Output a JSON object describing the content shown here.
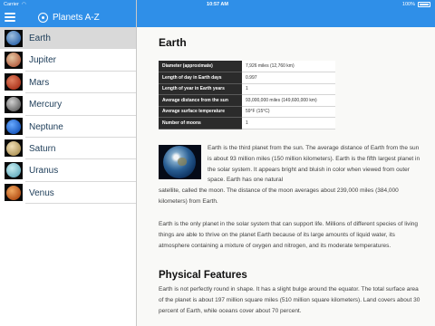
{
  "status_bar": {
    "carrier": "Carrier",
    "time": "10:57 AM",
    "battery": "100%"
  },
  "sidebar": {
    "title": "Planets A-Z",
    "planets": [
      {
        "name": "Earth",
        "selected": true,
        "colors": [
          "#3a6fb0",
          "#9fc0df"
        ]
      },
      {
        "name": "Jupiter",
        "selected": false,
        "colors": [
          "#b9684a",
          "#e4c7a3"
        ]
      },
      {
        "name": "Mars",
        "selected": false,
        "colors": [
          "#b13a22",
          "#e08060"
        ]
      },
      {
        "name": "Mercury",
        "selected": false,
        "colors": [
          "#6e6e6e",
          "#d0d0d0"
        ]
      },
      {
        "name": "Neptune",
        "selected": false,
        "colors": [
          "#1f5fc4",
          "#68a9ff"
        ]
      },
      {
        "name": "Saturn",
        "selected": false,
        "colors": [
          "#b59b60",
          "#f0dfb6"
        ]
      },
      {
        "name": "Uranus",
        "selected": false,
        "colors": [
          "#6fb4c4",
          "#c6eef2"
        ]
      },
      {
        "name": "Venus",
        "selected": false,
        "colors": [
          "#b9561b",
          "#f0a860"
        ]
      }
    ]
  },
  "detail": {
    "title": "Earth",
    "facts": [
      {
        "label": "Diameter (approximate)",
        "value": "7,926 miles (12,760 km)"
      },
      {
        "label": "Length of day in Earth days",
        "value": "0.997"
      },
      {
        "label": "Length of year in Earth years",
        "value": "1"
      },
      {
        "label": "Average distance from the sun",
        "value": "93,000,000 miles (149,600,000 km)"
      },
      {
        "label": "Average surface temperature",
        "value": "59°F (15°C)"
      },
      {
        "label": "Number of moons",
        "value": "1"
      }
    ],
    "para1_wrap": "Earth is the third planet from the sun. The average distance of Earth from the sun is about 93 million miles (150 million kilometers). Earth is the fifth largest planet in the solar system. It appears bright and bluish in color when viewed from outer space. Earth has one natural",
    "para1_rest": "satellite, called the moon. The distance of the moon averages about 239,000 miles (384,000 kilometers) from Earth.",
    "para2": "Earth is the only planet in the solar system that can support life. Millions of different species of living things are able to thrive on the planet Earth because of its large amounts of liquid water, its atmosphere containing a mixture of oxygen and nitrogen, and its moderate temperatures.",
    "section_heading": "Physical Features",
    "para3": "Earth is not perfectly round in shape. It has a slight bulge around the equator. The total surface area of the planet is about 197 million square miles (510 million square kilometers). Land covers about 30 percent of Earth, while oceans cover about 70 percent."
  }
}
